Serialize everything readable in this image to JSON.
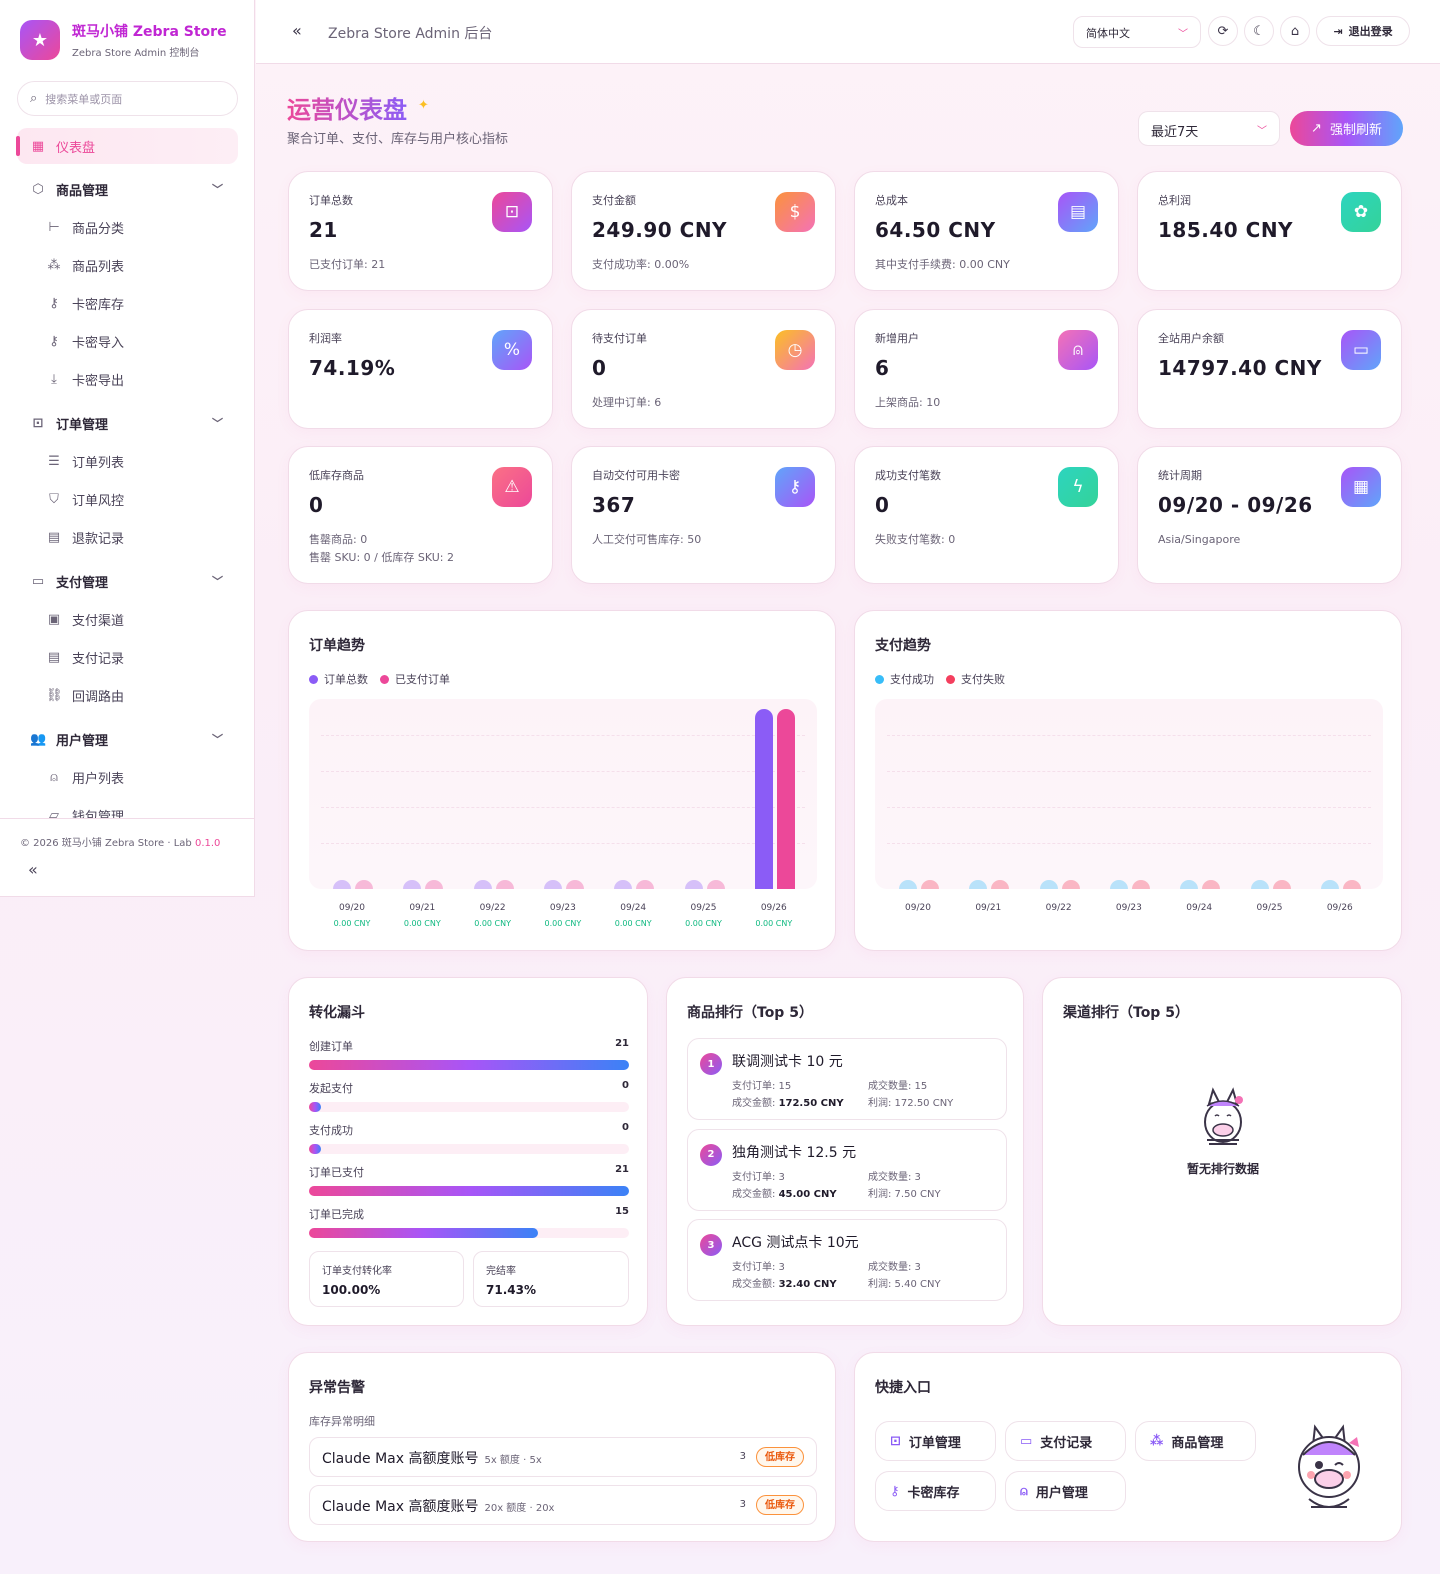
{
  "sidebar": {
    "brand_title": "斑马小铺 Zebra Store",
    "brand_sub": "Zebra Store Admin 控制台",
    "search_placeholder": "搜索菜单或页面",
    "nav": {
      "dashboard": "仪表盘",
      "goods_group": "商品管理",
      "goods_category": "商品分类",
      "goods_list": "商品列表",
      "card_stock": "卡密库存",
      "card_import": "卡密导入",
      "card_export": "卡密导出",
      "order_group": "订单管理",
      "order_list": "订单列表",
      "order_risk": "订单风控",
      "refund_records": "退款记录",
      "pay_group": "支付管理",
      "pay_channels": "支付渠道",
      "pay_records": "支付记录",
      "callback_route": "回调路由",
      "user_group": "用户管理",
      "user_list": "用户列表",
      "wallet_manage": "钱包管理"
    },
    "footer_text": "© 2026 斑马小铺 Zebra Store · Lab",
    "footer_version": "0.1.0"
  },
  "topbar": {
    "title": "Zebra Store Admin 后台",
    "language": "简体中文",
    "logout": "退出登录"
  },
  "header": {
    "title": "运营仪表盘",
    "subtitle": "聚合订单、支付、库存与用户核心指标",
    "period": "最近7天",
    "refresh": "强制刷新"
  },
  "stats": [
    {
      "label": "订单总数",
      "value": "21",
      "sub": "已支付订单: 21",
      "sub2": "",
      "icon": "bag-icon",
      "color": "#ec4899",
      "color2": "#a855f7"
    },
    {
      "label": "支付金额",
      "value": "249.90 CNY",
      "sub": "支付成功率: 0.00%",
      "sub2": "",
      "icon": "dollar-icon",
      "color": "#fb923c",
      "color2": "#f472b6"
    },
    {
      "label": "总成本",
      "value": "64.50 CNY",
      "sub": "其中支付手续费: 0.00 CNY",
      "sub2": "",
      "icon": "receipt-icon",
      "color": "#a855f7",
      "color2": "#60a5fa"
    },
    {
      "label": "总利润",
      "value": "185.40 CNY",
      "sub": "",
      "sub2": "",
      "icon": "piggy-bank-icon",
      "color": "#2dd4bf",
      "color2": "#34d399"
    },
    {
      "label": "利润率",
      "value": "74.19%",
      "sub": "",
      "sub2": "",
      "icon": "percent-icon",
      "color": "#60a5fa",
      "color2": "#a855f7"
    },
    {
      "label": "待支付订单",
      "value": "0",
      "sub": "处理中订单: 6",
      "sub2": "",
      "icon": "clock-icon",
      "color": "#fbbf24",
      "color2": "#f472b6"
    },
    {
      "label": "新增用户",
      "value": "6",
      "sub": "上架商品: 10",
      "sub2": "",
      "icon": "user-plus-icon",
      "color": "#f472b6",
      "color2": "#a855f7"
    },
    {
      "label": "全站用户余额",
      "value": "14797.40 CNY",
      "sub": "",
      "sub2": "",
      "icon": "wallet-icon",
      "color": "#a855f7",
      "color2": "#60a5fa"
    },
    {
      "label": "低库存商品",
      "value": "0",
      "sub": "售罄商品: 0",
      "sub2": "售罄 SKU: 0 / 低库存 SKU: 2",
      "icon": "alert-triangle-icon",
      "color": "#fb7185",
      "color2": "#ec4899"
    },
    {
      "label": "自动交付可用卡密",
      "value": "367",
      "sub": "人工交付可售库存: 50",
      "sub2": "",
      "icon": "key-icon",
      "color": "#60a5fa",
      "color2": "#a855f7"
    },
    {
      "label": "成功支付笔数",
      "value": "0",
      "sub": "失败支付笔数: 0",
      "sub2": "",
      "icon": "lightning-icon",
      "color": "#2dd4bf",
      "color2": "#34d399"
    },
    {
      "label": "统计周期",
      "value": "09/20 - 09/26",
      "sub": "Asia/Singapore",
      "sub2": "",
      "icon": "calendar-icon",
      "color": "#a855f7",
      "color2": "#60a5fa"
    }
  ],
  "order_trend": {
    "title": "订单趋势",
    "legend": [
      "订单总数",
      "已支付订单"
    ],
    "dates": [
      "09/20",
      "09/21",
      "09/22",
      "09/23",
      "09/24",
      "09/25",
      "09/26"
    ],
    "amounts": [
      "0.00 CNY",
      "0.00 CNY",
      "0.00 CNY",
      "0.00 CNY",
      "0.00 CNY",
      "0.00 CNY",
      "0.00 CNY"
    ]
  },
  "pay_trend": {
    "title": "支付趋势",
    "legend": [
      "支付成功",
      "支付失败"
    ],
    "dates": [
      "09/20",
      "09/21",
      "09/22",
      "09/23",
      "09/24",
      "09/25",
      "09/26"
    ]
  },
  "chart_data": [
    {
      "type": "bar",
      "title": "订单趋势",
      "categories": [
        "09/20",
        "09/21",
        "09/22",
        "09/23",
        "09/24",
        "09/25",
        "09/26"
      ],
      "series": [
        {
          "name": "订单总数",
          "values": [
            0,
            0,
            0,
            0,
            0,
            0,
            21
          ],
          "color": "#8b5cf6"
        },
        {
          "name": "已支付订单",
          "values": [
            0,
            0,
            0,
            0,
            0,
            0,
            21
          ],
          "color": "#ec4899"
        }
      ],
      "ylim": [
        0,
        21
      ]
    },
    {
      "type": "bar",
      "title": "支付趋势",
      "categories": [
        "09/20",
        "09/21",
        "09/22",
        "09/23",
        "09/24",
        "09/25",
        "09/26"
      ],
      "series": [
        {
          "name": "支付成功",
          "values": [
            0,
            0,
            0,
            0,
            0,
            0,
            0
          ],
          "color": "#38bdf8"
        },
        {
          "name": "支付失败",
          "values": [
            0,
            0,
            0,
            0,
            0,
            0,
            0
          ],
          "color": "#f43f5e"
        }
      ]
    }
  ],
  "funnel": {
    "title": "转化漏斗",
    "rows": [
      {
        "label": "创建订单",
        "value": "21",
        "pct": 100
      },
      {
        "label": "发起支付",
        "value": "0",
        "pct": 0
      },
      {
        "label": "支付成功",
        "value": "0",
        "pct": 0
      },
      {
        "label": "订单已支付",
        "value": "21",
        "pct": 100
      },
      {
        "label": "订单已完成",
        "value": "15",
        "pct": 71.43
      }
    ],
    "pay_rate_label": "订单支付转化率",
    "pay_rate": "100.00%",
    "done_rate_label": "完结率",
    "done_rate": "71.43%"
  },
  "product_rank": {
    "title": "商品排行（Top 5）",
    "items": [
      {
        "rank": "1",
        "name": "联调测试卡 10 元",
        "orders": "支付订单: 15",
        "qty": "成交数量: 15",
        "amount_label": "成交金额: ",
        "amount": "172.50 CNY",
        "profit": "利润: 172.50 CNY"
      },
      {
        "rank": "2",
        "name": "独角测试卡 12.5 元",
        "orders": "支付订单: 3",
        "qty": "成交数量: 3",
        "amount_label": "成交金额: ",
        "amount": "45.00 CNY",
        "profit": "利润: 7.50 CNY"
      },
      {
        "rank": "3",
        "name": "ACG 测试点卡 10元",
        "orders": "支付订单: 3",
        "qty": "成交数量: 3",
        "amount_label": "成交金额: ",
        "amount": "32.40 CNY",
        "profit": "利润: 5.40 CNY"
      }
    ]
  },
  "channel_rank": {
    "title": "渠道排行（Top 5）",
    "empty": "暂无排行数据"
  },
  "alerts": {
    "title": "异常告警",
    "subtitle": "库存异常明细",
    "items": [
      {
        "name": "Claude Max 高额度账号",
        "detail": "5x 额度 · 5x",
        "count": "3",
        "tag": "低库存"
      },
      {
        "name": "Claude Max 高额度账号",
        "detail": "20x 额度 · 20x",
        "count": "3",
        "tag": "低库存"
      }
    ]
  },
  "quick": {
    "title": "快捷入口",
    "items": [
      "订单管理",
      "支付记录",
      "商品管理",
      "卡密库存",
      "用户管理"
    ]
  }
}
